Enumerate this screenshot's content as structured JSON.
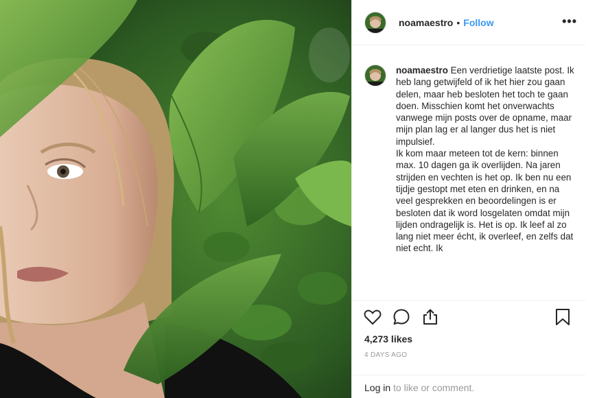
{
  "post": {
    "username": "noamaestro",
    "separator": "•",
    "follow_label": "Follow",
    "more_label": "•••",
    "caption_user": "noamaestro",
    "caption_text": " Een verdrietige laatste post. Ik heb lang getwijfeld of ik het hier zou gaan delen, maar heb besloten het toch te gaan doen. Misschien komt het onverwachts vanwege mijn posts over de opname, maar mijn plan lag er al langer dus het is niet impulsief.\nIk kom maar meteen tot de kern: binnen max. 10 dagen ga ik overlijden. Na jaren strijden en vechten is het op. Ik ben nu een tijdje gestopt met eten en drinken, en na veel gesprekken en beoordelingen is er besloten dat ik word losgelaten omdat mijn lijden ondragelijk is. Het is op. Ik leef al zo lang niet meer écht, ik overleef, en zelfs dat niet echt. Ik",
    "likes": "4,273 likes",
    "time": "4 DAYS AGO",
    "login_label": "Log in",
    "login_suffix": " to like or comment."
  },
  "icons": {
    "like": "heart-icon",
    "comment": "speech-bubble-icon",
    "share": "share-icon",
    "save": "bookmark-icon",
    "more": "ellipsis-icon"
  },
  "colors": {
    "accent": "#3897f0",
    "text": "#262626",
    "muted": "#999999",
    "border": "#efefef"
  }
}
